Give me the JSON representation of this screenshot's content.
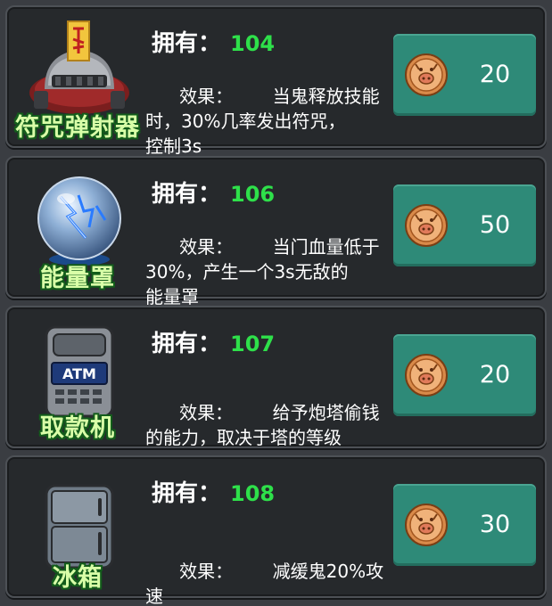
{
  "owned_label": "拥有：",
  "effect_label": "效果：",
  "items": [
    {
      "name": "符咒弹射器",
      "icon": "talisman-launcher-icon",
      "owned": "104",
      "effect": "       当鬼释放技能\n时，30%几率发出符咒，\n控制3s",
      "price": "20"
    },
    {
      "name": "能量罩",
      "icon": "energy-shield-icon",
      "owned": "106",
      "effect": "       当门血量低于\n30%，产生一个3s无敌的\n能量罩",
      "price": "50"
    },
    {
      "name": "取款机",
      "icon": "atm-icon",
      "atm_text": "ATM",
      "owned": "107",
      "effect": "       给予炮塔偷钱\n的能力，取决于塔的等级",
      "price": "20"
    },
    {
      "name": "冰箱",
      "icon": "fridge-icon",
      "owned": "108",
      "effect": "       减缓鬼20%攻速",
      "price": "30"
    }
  ],
  "colors": {
    "card_bg": "#26292c",
    "owned_count": "#2ee04a",
    "buy_button": "#2e8a78",
    "item_name_outline": "#135c1b"
  },
  "currency_icon": "pig-coin-icon"
}
